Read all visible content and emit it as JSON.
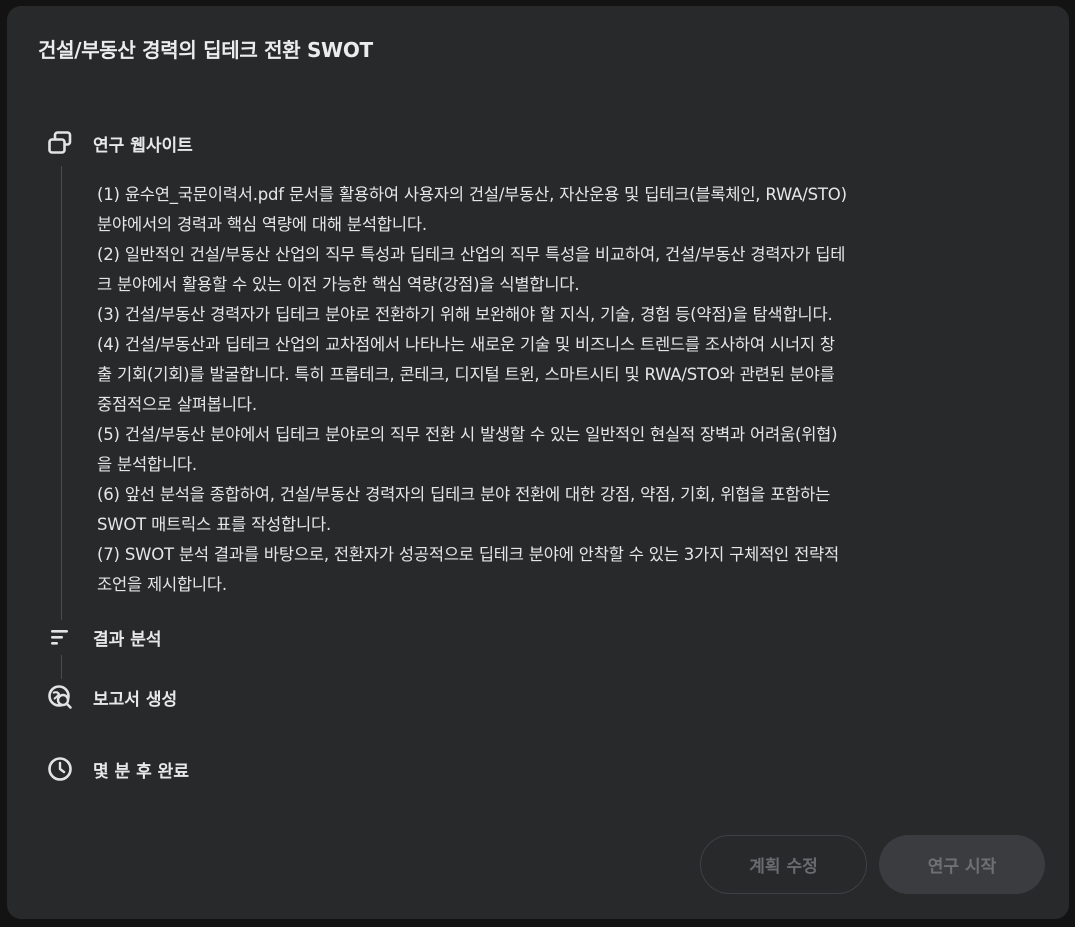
{
  "title": "건설/부동산 경력의 딥테크 전환 SWOT",
  "steps": [
    {
      "icon": "web-pages-icon",
      "label": "연구 웹사이트"
    },
    {
      "icon": "analysis-lines-icon",
      "label": "결과 분석"
    },
    {
      "icon": "report-search-icon",
      "label": "보고서 생성"
    },
    {
      "icon": "clock-icon",
      "label": "몇 분 후 완료"
    }
  ],
  "plan_lines": [
    "(1) 윤수연_국문이력서.pdf 문서를 활용하여 사용자의 건설/부동산, 자산운용 및 딥테크(블록체인, RWA/STO)",
    "분야에서의 경력과 핵심 역량에 대해 분석합니다.",
    "(2) 일반적인 건설/부동산 산업의 직무 특성과 딥테크 산업의 직무 특성을 비교하여, 건설/부동산 경력자가 딥테",
    "크 분야에서 활용할 수 있는 이전 가능한 핵심 역량(강점)을 식별합니다.",
    "(3) 건설/부동산 경력자가 딥테크 분야로 전환하기 위해 보완해야 할 지식, 기술, 경험 등(약점)을 탐색합니다.",
    "(4) 건설/부동산과 딥테크 산업의 교차점에서 나타나는 새로운 기술 및 비즈니스 트렌드를 조사하여 시너지 창",
    "출 기회(기회)를 발굴합니다. 특히 프롭테크, 콘테크, 디지털 트윈, 스마트시티 및 RWA/STO와 관련된 분야를",
    "중점적으로 살펴봅니다.",
    "(5) 건설/부동산 분야에서 딥테크 분야로의 직무 전환 시 발생할 수 있는 일반적인 현실적 장벽과 어려움(위협)",
    "을 분석합니다.",
    "(6) 앞선 분석을 종합하여, 건설/부동산 경력자의 딥테크 분야 전환에 대한 강점, 약점, 기회, 위협을 포함하는",
    "SWOT 매트릭스 표를 작성합니다.",
    "(7) SWOT 분석 결과를 바탕으로, 전환자가 성공적으로 딥테크 분야에 안착할 수 있는 3가지 구체적인 전략적",
    "조언을 제시합니다."
  ],
  "buttons": {
    "edit_plan": "계획 수정",
    "start_research": "연구 시작"
  }
}
